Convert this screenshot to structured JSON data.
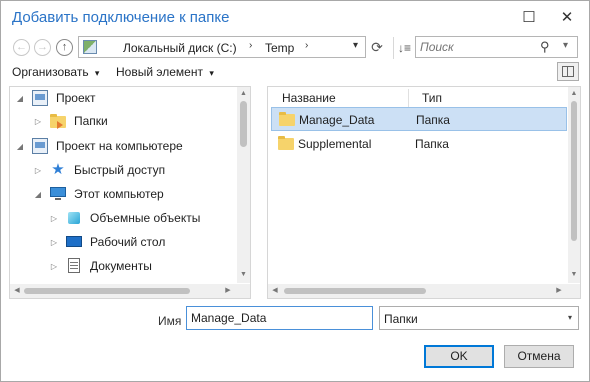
{
  "window": {
    "title": "Добавить подключение к папке",
    "minimize_glyph": "☐",
    "close_glyph": "✕"
  },
  "nav": {
    "back_glyph": "←",
    "forward_glyph": "→",
    "up_glyph": "↑",
    "address": {
      "segments": [
        "Локальный диск (C:)",
        "Temp"
      ],
      "separator_glyph": "›",
      "dropdown_glyph": "▾"
    },
    "refresh_glyph": "⟳",
    "sort_glyph": "↓≡",
    "search": {
      "placeholder": "Поиск",
      "icon_glyph": "⚲",
      "chevron_glyph": "▾"
    }
  },
  "toolbar": {
    "organize_label": "Организовать",
    "organize_chevron": "▾",
    "new_item_label": "Новый элемент",
    "new_item_chevron": "▾"
  },
  "tree": [
    {
      "label": "Проект",
      "expander": "◢",
      "icon": "project-icon"
    },
    {
      "label": "Папки",
      "expander": "▷",
      "icon": "folder-icon"
    },
    {
      "label": "Проект на компьютере",
      "expander": "◢",
      "icon": "project-computer-icon"
    },
    {
      "label": "Быстрый доступ",
      "expander": "▷",
      "icon": "quick-access-star-icon"
    },
    {
      "label": "Этот компьютер",
      "expander": "◢",
      "icon": "this-pc-icon"
    },
    {
      "label": "Объемные объекты",
      "expander": "▷",
      "icon": "3d-objects-icon"
    },
    {
      "label": "Рабочий стол",
      "expander": "▷",
      "icon": "desktop-icon"
    },
    {
      "label": "Документы",
      "expander": "▷",
      "icon": "documents-icon"
    }
  ],
  "list": {
    "columns": {
      "name": "Название",
      "type": "Тип"
    },
    "rows": [
      {
        "name": "Manage_Data",
        "type": "Папка",
        "selected": true
      },
      {
        "name": "Supplemental",
        "type": "Папка",
        "selected": false
      }
    ]
  },
  "footer": {
    "name_label": "Имя",
    "name_value": "Manage_Data",
    "type_value": "Папки",
    "type_chevron": "▾",
    "ok_label": "OK",
    "cancel_label": "Отмена"
  },
  "colors": {
    "title": "#2b74c7",
    "selection": "#cce0f5",
    "folder": "#f6d36b",
    "primary_border": "#0078d7"
  }
}
